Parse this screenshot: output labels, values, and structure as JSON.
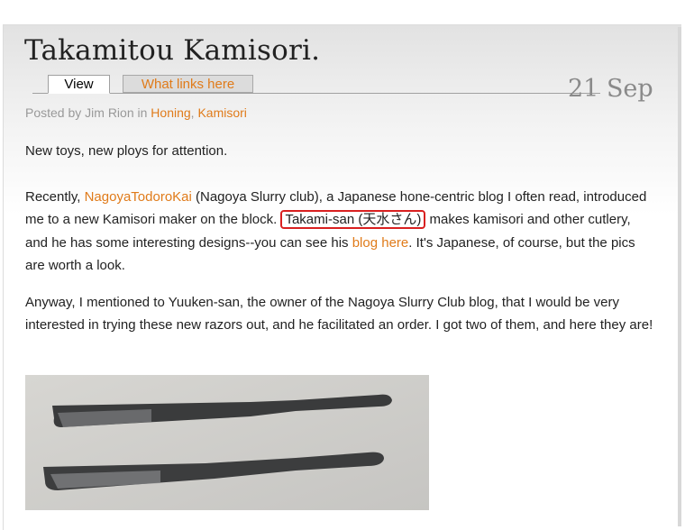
{
  "post": {
    "title": "Takamitou Kamisori.",
    "date": "21 Sep",
    "tabs": {
      "view": "View",
      "what_links": "What links here"
    },
    "meta": {
      "prefix": "Posted by Jim Rion in",
      "category1": "Honing",
      "separator": ",",
      "category2": "Kamisori"
    },
    "paragraphs": {
      "p1": "New toys, new ploys for attention.",
      "p2_prefix": "Recently,",
      "p2_link1": "NagoyaTodoroKai",
      "p2_mid1": "(Nagoya Slurry club), a Japanese hone-centric blog I often read, introduced me to a new Kamisori maker on the block.",
      "p2_highlight": "Takami-san (天水さん)",
      "p2_mid2": "makes kamisori and other cutlery, and he has some interesting designs--you can see his",
      "p2_link2": "blog here",
      "p2_suffix": ". It's Japanese, of course, but the pics are worth a look.",
      "p3": "Anyway, I mentioned to Yuuken-san, the owner of the Nagoya Slurry Club blog, that I would be very interested in trying these new razors out, and he facilitated an order. I got two of them, and here they are!"
    },
    "image": {
      "icon": "kamisori-razors-photo"
    }
  },
  "colors": {
    "link": "#e07b1a",
    "highlight_border": "#d92020",
    "date": "#8a8a8a"
  }
}
